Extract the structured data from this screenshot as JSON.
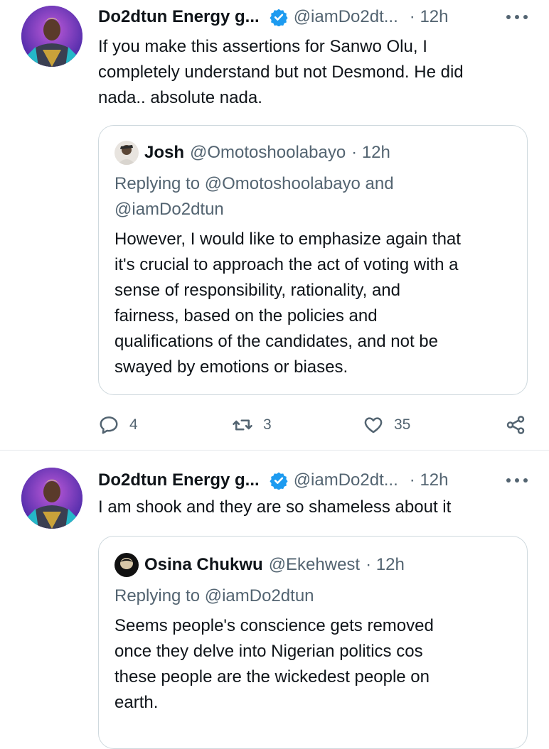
{
  "colors": {
    "text": "#0f1419",
    "secondary": "#536471",
    "border": "#cfd9de",
    "verified": "#1d9bf0",
    "divider": "#e6e9ec"
  },
  "tweets": [
    {
      "author": {
        "name": "Do2dtun Energy g...",
        "handle": "@iamDo2dt...",
        "time": "· 12h",
        "avatar_icon": "profile-avatar",
        "verified": true
      },
      "text_lines": [
        "If you make this assertions for Sanwo Olu, I",
        "completely understand but not Desmond. He did",
        "nada.. absolute nada."
      ],
      "quote": {
        "name": "Josh",
        "handle": "@Omotoshoolabayo",
        "time": "· 12h",
        "replying_lines": [
          "Replying to @Omotoshoolabayo and",
          "@iamDo2dtun"
        ],
        "text_lines": [
          "However, I would like to emphasize again that",
          "it's crucial to approach the act of voting with a",
          "sense of responsibility, rationality, and",
          "fairness, based on the policies and",
          "qualifications of the candidates, and not be",
          "swayed by emotions or biases."
        ]
      },
      "actions": {
        "replies": "4",
        "retweets": "3",
        "likes": "35"
      }
    },
    {
      "author": {
        "name": "Do2dtun Energy g...",
        "handle": "@iamDo2dt...",
        "time": "· 12h",
        "avatar_icon": "profile-avatar",
        "verified": true
      },
      "text_lines": [
        "I am shook and they are so shameless about it"
      ],
      "quote": {
        "name": "Osina Chukwu",
        "handle": "@Ekehwest",
        "time": "· 12h",
        "replying_lines": [
          "Replying to @iamDo2dtun"
        ],
        "text_lines": [
          "Seems people's conscience gets removed",
          "once they delve into Nigerian politics cos",
          "these people are the wickedest people on",
          "earth."
        ]
      }
    }
  ]
}
